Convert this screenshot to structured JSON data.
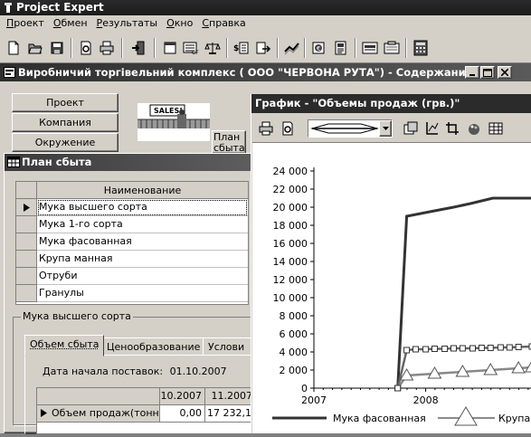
{
  "app": {
    "title": "Project Expert",
    "menu": [
      "Проект",
      "Обмен",
      "Результаты",
      "Окно",
      "Справка"
    ]
  },
  "toolbar_icons": [
    "new-file-icon",
    "open-folder-icon",
    "save-icon",
    "preview-icon",
    "print-icon",
    "exit-icon",
    "window-icon",
    "cashflow-icon",
    "balance-icon",
    "report-icon",
    "export-icon",
    "trend-icon",
    "finance-icon",
    "document-icon",
    "layout-icon",
    "form-icon",
    "calculator-icon"
  ],
  "doc_window": {
    "title": "Виробничий торгівельний комплекс ( ООО \"ЧЕРВОНА РУТА\") - Содержание",
    "nav": [
      "Проект",
      "Компания",
      "Окружение"
    ],
    "sales_sign": "SALES!",
    "sales_label_line1": "План",
    "sales_label_line2": "сбыта"
  },
  "plan_window": {
    "title": "План сбыта",
    "column_header": "Наименование",
    "products": [
      "Мука высшего сорта",
      "Мука 1-го сорта",
      "Мука фасованная",
      "Крупа манная",
      "Отруби",
      "Гранулы"
    ],
    "selected_product": "Мука высшего сорта",
    "tabs": [
      "Объем сбыта",
      "Ценообразование",
      "Услови"
    ],
    "active_tab": "Объем сбыта",
    "date_label": "Дата начала поставок:",
    "date_value": "01.10.2007",
    "volume_table": {
      "columns": [
        "10.2007",
        "11.2007"
      ],
      "row_label": "Объем продаж(тонн)",
      "values": [
        "0,00",
        "17 232,14"
      ]
    }
  },
  "chart_window": {
    "title": "График - \"Объемы продаж (грв.)\"",
    "toolbar_icons": [
      "print-icon",
      "preview-icon",
      "line-style-dropdown",
      "gallery-icon",
      "axis-icon",
      "crop-icon",
      "color-icon",
      "table-icon"
    ]
  },
  "chart_data": {
    "type": "line",
    "x_tick_labels": [
      "2007",
      "2008",
      "20"
    ],
    "y_tick_labels": [
      "0",
      "2 000",
      "4 000",
      "6 000",
      "8 000",
      "10 000",
      "12 000",
      "14 000",
      "16 000",
      "18 000",
      "20 000",
      "22 000",
      "24 000"
    ],
    "ylim": [
      0,
      24000
    ],
    "xlim": [
      2007.0,
      2008.95
    ],
    "series": [
      {
        "name": "Мука фасованная",
        "color": "#333333",
        "marker": "none",
        "x": [
          2007.75,
          2007.83,
          2008.08,
          2008.25,
          2008.4,
          2008.6,
          2008.75,
          2008.95
        ],
        "y": [
          0,
          19000,
          19600,
          20000,
          20400,
          21000,
          21000,
          21000
        ]
      },
      {
        "name": "",
        "color": "#666666",
        "marker": "square",
        "x": [
          2007.75,
          2007.83,
          2007.91,
          2008.0,
          2008.08,
          2008.17,
          2008.25,
          2008.33,
          2008.42,
          2008.5,
          2008.58,
          2008.67,
          2008.75,
          2008.83,
          2008.95
        ],
        "y": [
          0,
          4200,
          4300,
          4300,
          4350,
          4350,
          4400,
          4400,
          4400,
          4450,
          4450,
          4500,
          4500,
          4550,
          4600
        ]
      },
      {
        "name": "Крупа м",
        "color": "#888888",
        "marker": "triangle",
        "x": [
          2007.75,
          2007.83,
          2008.08,
          2008.33,
          2008.58,
          2008.83,
          2008.95
        ],
        "y": [
          0,
          1400,
          1600,
          1800,
          2000,
          2200,
          2300
        ]
      }
    ],
    "legend": [
      "Мука фасованная",
      "Крупа м"
    ],
    "legend_placement": "bottom",
    "grid": false
  }
}
